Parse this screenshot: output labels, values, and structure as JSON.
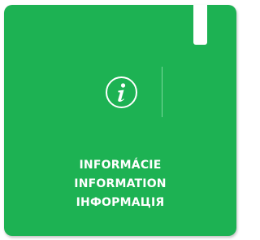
{
  "sign": {
    "background_color": "#1db253",
    "icon": "info-icon",
    "labels": [
      "INFORMÁCIE",
      "INFORMATION",
      "ІНФОРМАЦІЯ"
    ]
  }
}
